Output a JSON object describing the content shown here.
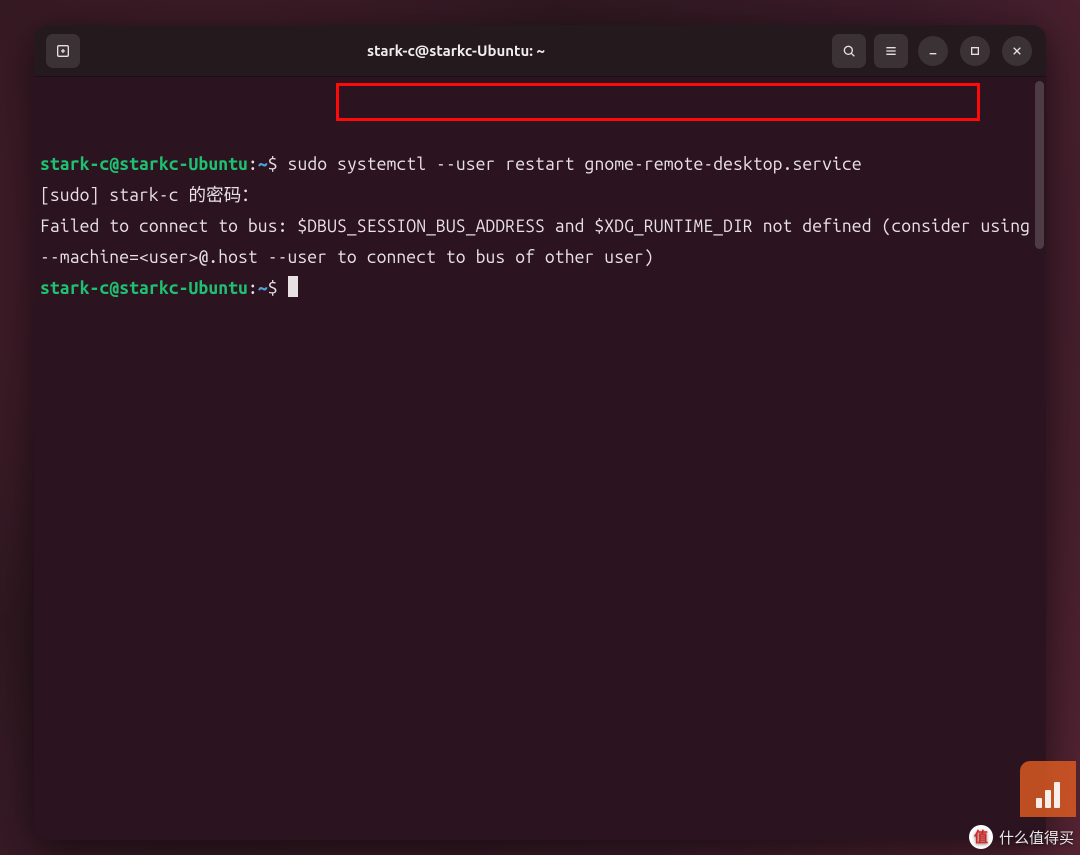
{
  "titlebar": {
    "title": "stark-c@starkc-Ubuntu: ~"
  },
  "terminal": {
    "prompt1": {
      "user": "stark-c",
      "at": "@",
      "host": "starkc-Ubuntu",
      "colon": ":",
      "path": "~",
      "dollar": "$ ",
      "command": "sudo systemctl --user restart gnome-remote-desktop.service"
    },
    "line2": "[sudo] stark-c 的密码：",
    "line3": "Failed to connect to bus: $DBUS_SESSION_BUS_ADDRESS and $XDG_RUNTIME_DIR not defined (consider using --machine=<user>@.host --user to connect to bus of other user)",
    "prompt2": {
      "user": "stark-c",
      "at": "@",
      "host": "starkc-Ubuntu",
      "colon": ":",
      "path": "~",
      "dollar": "$ "
    }
  },
  "watermark": {
    "badge": "值",
    "text": "什么值得买"
  }
}
